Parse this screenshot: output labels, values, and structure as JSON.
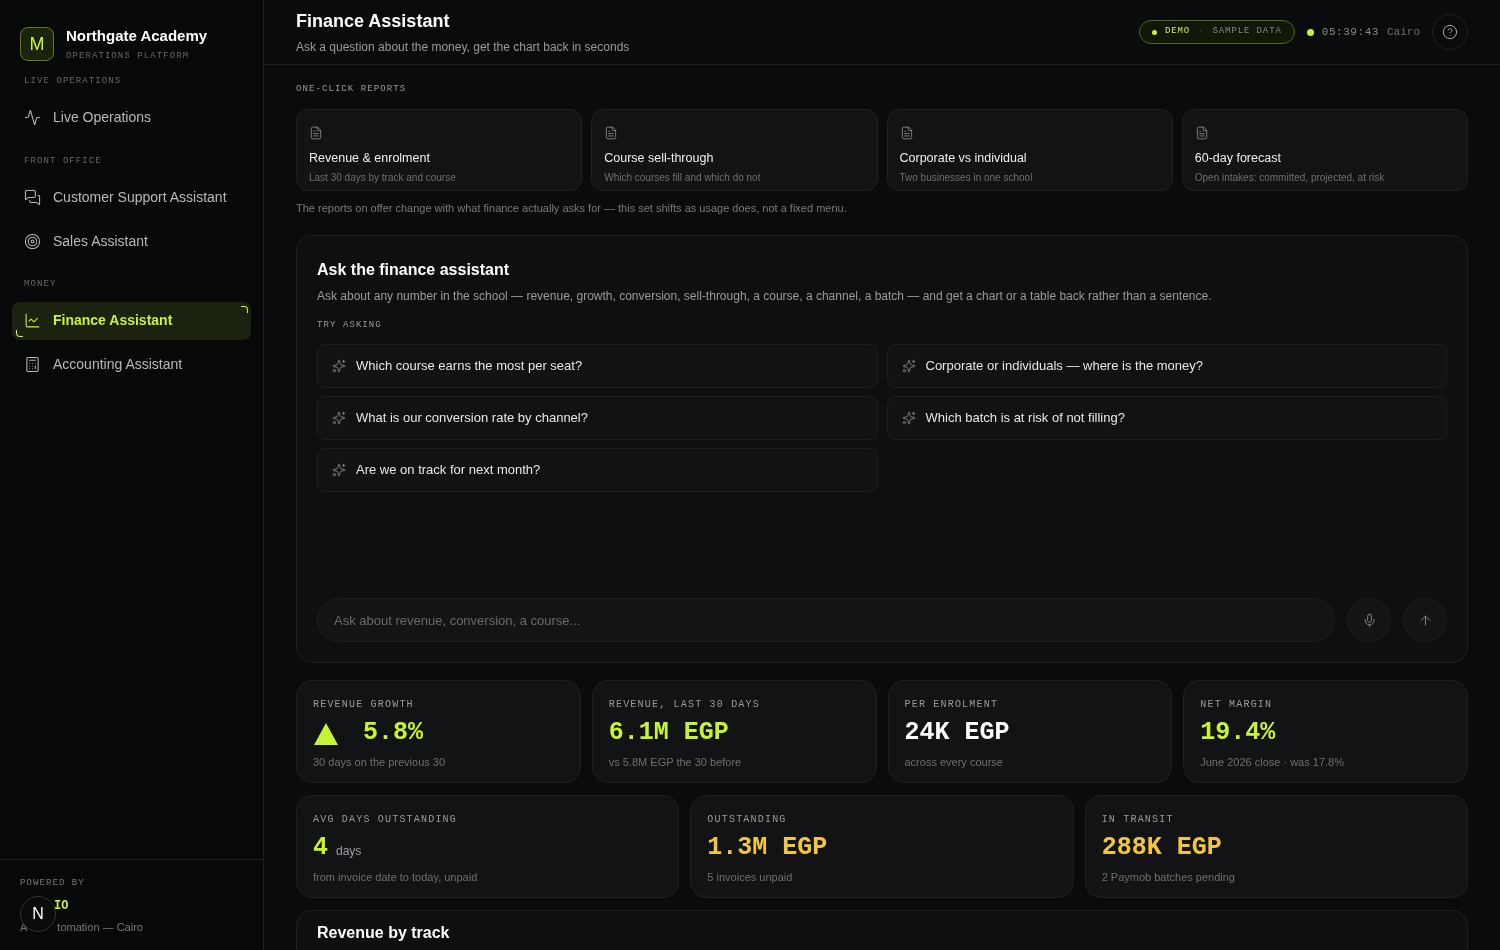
{
  "brand": {
    "logo_letter": "M",
    "name": "Northgate Academy",
    "subtitle": "OPERATIONS PLATFORM"
  },
  "sidebar": {
    "sections": [
      {
        "heading": "LIVE OPERATIONS",
        "items": [
          {
            "label": "Live Operations",
            "kind": "pulse",
            "selected": false
          }
        ]
      },
      {
        "heading": "FRONT OFFICE",
        "items": [
          {
            "label": "Customer Support Assistant",
            "kind": "chat",
            "selected": false
          },
          {
            "label": "Sales Assistant",
            "kind": "target",
            "selected": false
          }
        ]
      },
      {
        "heading": "MONEY",
        "items": [
          {
            "label": "Finance Assistant",
            "kind": "chart",
            "selected": true
          },
          {
            "label": "Accounting Assistant",
            "kind": "calculator",
            "selected": false
          }
        ]
      }
    ],
    "footer": {
      "label": "POWERED BY",
      "brand": "IO",
      "tagline_start": "A",
      "tagline_end": "tomation — Cairo",
      "badge": "N"
    }
  },
  "header": {
    "title": "Finance Assistant",
    "subtitle": "Ask a question about the money, get the chart back in seconds",
    "badge_mode": "DEMO",
    "badge_separator": "·",
    "badge_note": "SAMPLE DATA",
    "clock": "05:39:43",
    "city": "Cairo"
  },
  "reports": {
    "heading": "ONE-CLICK REPORTS",
    "items": [
      {
        "title": "Revenue & enrolment",
        "subtitle": "Last 30 days by track and course"
      },
      {
        "title": "Course sell-through",
        "subtitle": "Which courses fill and which do not"
      },
      {
        "title": "Corporate vs individual",
        "subtitle": "Two businesses in one school"
      },
      {
        "title": "60-day forecast",
        "subtitle": "Open intakes: committed, projected, at risk"
      }
    ],
    "note": "The reports on offer change with what finance actually asks for — this set shifts as usage does, not a fixed menu."
  },
  "assistant": {
    "title": "Ask the finance assistant",
    "description": "Ask about any number in the school — revenue, growth, conversion, sell-through, a course, a channel, a batch — and get a chart or a table back rather than a sentence.",
    "try_heading": "TRY ASKING",
    "suggestions": [
      "Which course earns the most per seat?",
      "Corporate or individuals — where is the money?",
      "What is our conversion rate by channel?",
      "Which batch is at risk of not filling?",
      "Are we on track for next month?"
    ],
    "input": {
      "placeholder": "Ask about revenue, conversion, a course..."
    }
  },
  "kpis": [
    {
      "trend_up": true,
      "label": "REVENUE GROWTH",
      "value": "5.8%",
      "note": "30 days on the previous 30",
      "color": "#c6f432"
    },
    {
      "trend_up": false,
      "label": "REVENUE, LAST 30 DAYS",
      "value": "6.1M EGP",
      "note": "vs 5.8M EGP the 30 before",
      "color": "#c6f432"
    },
    {
      "trend_up": false,
      "label": "PER ENROLMENT",
      "value": "24K EGP",
      "note": "across every course",
      "color": "#ffffff"
    },
    {
      "trend_up": false,
      "label": "NET MARGIN",
      "value": "19.4%",
      "note": "June 2026 close · was 17.8%",
      "color": "#c6f432"
    }
  ],
  "kpis_secondary": [
    {
      "label": "AVG DAYS OUTSTANDING",
      "value": "4",
      "unit": "days",
      "note": "from invoice date to today, unpaid",
      "color": "#c6f432"
    },
    {
      "label": "OUTSTANDING",
      "value": "1.3M EGP",
      "note": "5 invoices unpaid",
      "color": "#f2c53d"
    },
    {
      "label": "IN TRANSIT",
      "value": "288K EGP",
      "note": "2 Paymob batches pending",
      "color": "#f2c53d"
    }
  ],
  "next_section": {
    "title": "Revenue by track"
  }
}
